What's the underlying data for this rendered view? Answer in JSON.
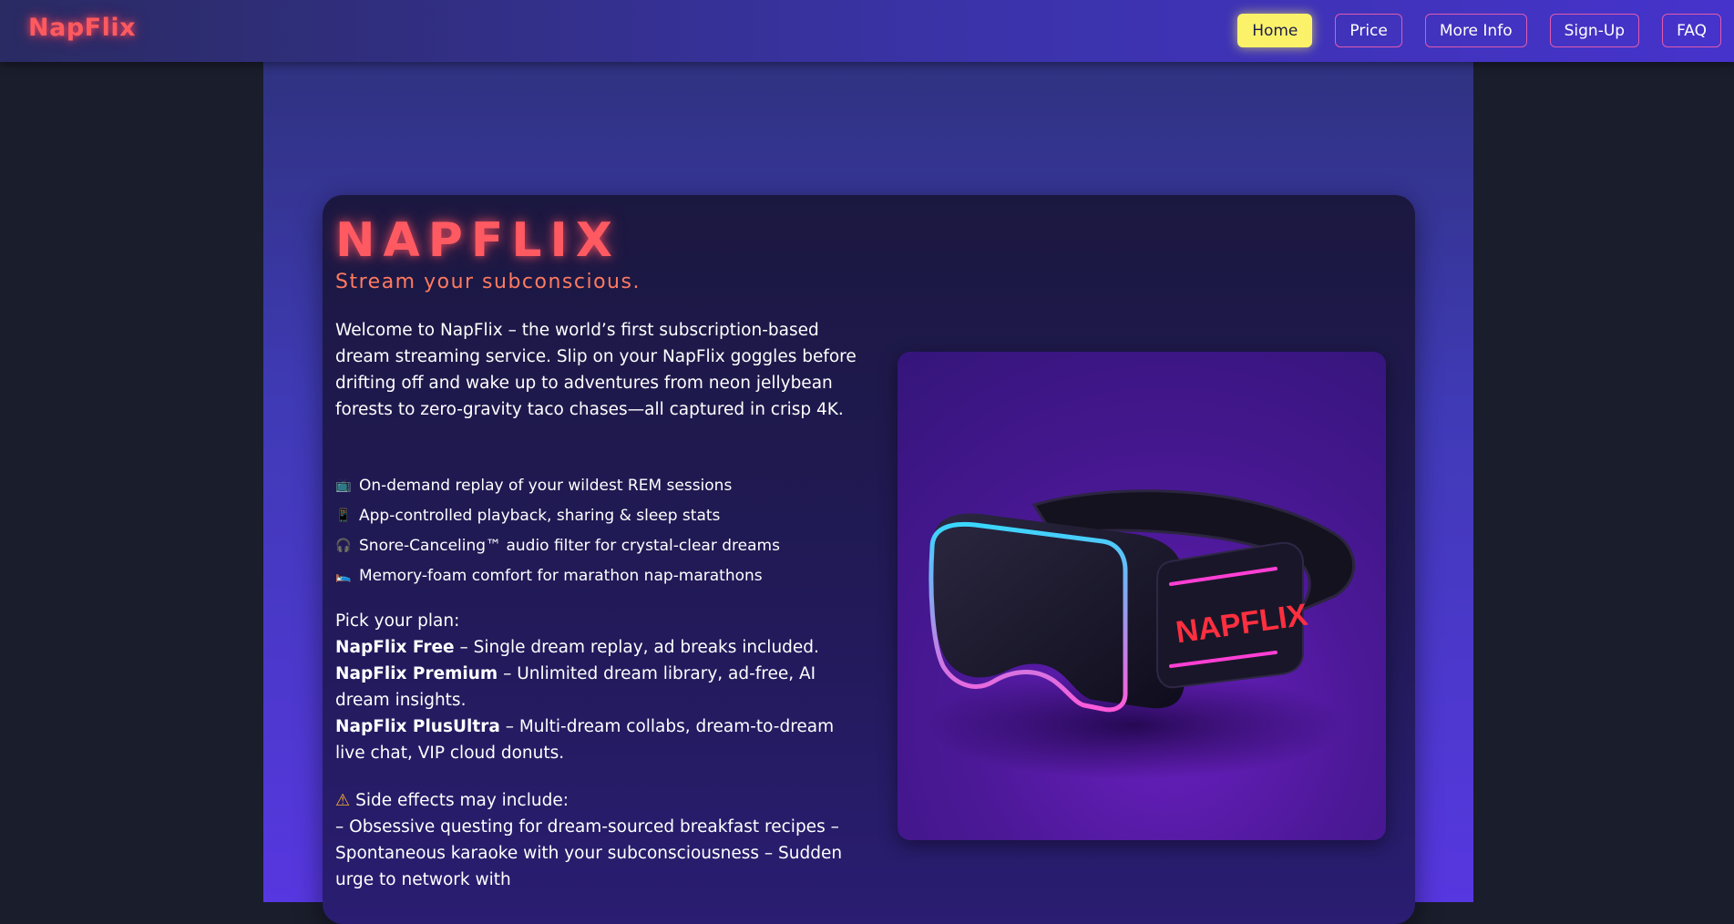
{
  "nav": {
    "brand": "NapFlix",
    "links": [
      {
        "label": "Home",
        "active": true
      },
      {
        "label": "Price",
        "active": false
      },
      {
        "label": "More Info",
        "active": false
      },
      {
        "label": "Sign-Up",
        "active": false
      },
      {
        "label": "FAQ",
        "active": false
      }
    ]
  },
  "hero": {
    "title": "NAPFLIX",
    "tagline": "Stream your subconscious.",
    "intro": "Welcome to NapFlix – the world’s first subscription-based dream streaming service. Slip on your NapFlix goggles before drifting off and wake up to adventures from neon jellybean forests to zero-gravity taco chases—all captured in crisp 4K.",
    "features": [
      {
        "icon": "📺",
        "icon_name": "tv-icon",
        "text": "On-demand replay of your wildest REM sessions"
      },
      {
        "icon": "📱",
        "icon_name": "phone-icon",
        "text": "App-controlled playback, sharing & sleep stats"
      },
      {
        "icon": "🎧",
        "icon_name": "headphones-icon",
        "text": "Snore-Canceling™ audio filter for crystal-clear dreams"
      },
      {
        "icon": "🛌",
        "icon_name": "bed-icon",
        "text": "Memory-foam comfort for marathon nap-marathons"
      }
    ],
    "plans_intro": "Pick your plan:",
    "plans": [
      {
        "name": "NapFlix Free",
        "desc": " – Single dream replay, ad breaks included."
      },
      {
        "name": "NapFlix Premium",
        "desc": " – Unlimited dream library, ad-free, AI dream insights."
      },
      {
        "name": "NapFlix PlusUltra",
        "desc": " – Multi-dream collabs, dream-to-dream live chat, VIP cloud donuts."
      }
    ],
    "warning_icon": "⚠",
    "warning_title": "Side effects may include:",
    "warning_text": "– Obsessive questing for dream-sourced breakfast recipes – Spontaneous karaoke with your subconsciousness – Sudden urge to network with"
  },
  "product_image": {
    "logo_text": "NAPFLIX",
    "alt": "NapFlix VR goggles"
  },
  "colors": {
    "brand_red": "#ff5a5f",
    "nav_active": "#fbf26a",
    "nav_border": "#e05ab0",
    "tagline": "#ff7a5f"
  }
}
